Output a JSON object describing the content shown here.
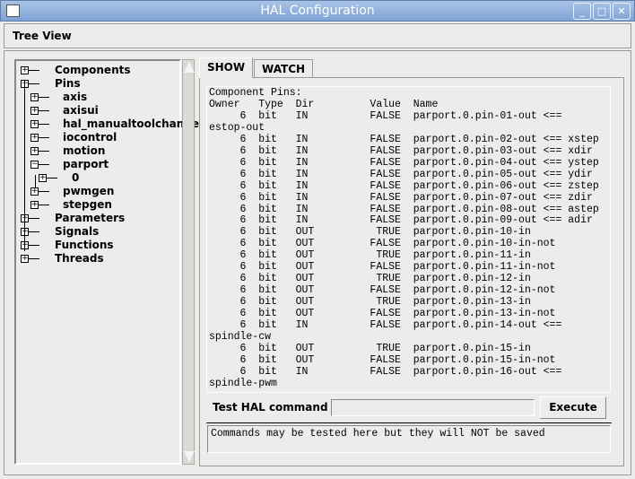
{
  "window": {
    "title": "HAL Configuration",
    "buttons": [
      "minimize",
      "maximize",
      "close"
    ]
  },
  "tree_view_label": "Tree View",
  "tree": [
    {
      "label": "Components",
      "level": 0,
      "expanded": false
    },
    {
      "label": "Pins",
      "level": 0,
      "expanded": true
    },
    {
      "label": "axis",
      "level": 1,
      "expanded": false
    },
    {
      "label": "axisui",
      "level": 1,
      "expanded": false
    },
    {
      "label": "hal_manualtoolchange",
      "level": 1,
      "expanded": false
    },
    {
      "label": "iocontrol",
      "level": 1,
      "expanded": false
    },
    {
      "label": "motion",
      "level": 1,
      "expanded": false
    },
    {
      "label": "parport",
      "level": 1,
      "expanded": true
    },
    {
      "label": "0",
      "level": 2,
      "expanded": false
    },
    {
      "label": "pwmgen",
      "level": 1,
      "expanded": false
    },
    {
      "label": "stepgen",
      "level": 1,
      "expanded": false
    },
    {
      "label": "Parameters",
      "level": 0,
      "expanded": false
    },
    {
      "label": "Signals",
      "level": 0,
      "expanded": false
    },
    {
      "label": "Functions",
      "level": 0,
      "expanded": false
    },
    {
      "label": "Threads",
      "level": 0,
      "expanded": false
    }
  ],
  "tabs": [
    {
      "label": "SHOW",
      "active": true
    },
    {
      "label": "WATCH",
      "active": false
    }
  ],
  "show_text": [
    "Component Pins:",
    "Owner   Type  Dir         Value  Name",
    "     6  bit   IN          FALSE  parport.0.pin-01-out <==",
    "estop-out",
    "     6  bit   IN          FALSE  parport.0.pin-02-out <== xstep",
    "     6  bit   IN          FALSE  parport.0.pin-03-out <== xdir",
    "     6  bit   IN          FALSE  parport.0.pin-04-out <== ystep",
    "     6  bit   IN          FALSE  parport.0.pin-05-out <== ydir",
    "     6  bit   IN          FALSE  parport.0.pin-06-out <== zstep",
    "     6  bit   IN          FALSE  parport.0.pin-07-out <== zdir",
    "     6  bit   IN          FALSE  parport.0.pin-08-out <== astep",
    "     6  bit   IN          FALSE  parport.0.pin-09-out <== adir",
    "     6  bit   OUT          TRUE  parport.0.pin-10-in",
    "     6  bit   OUT         FALSE  parport.0.pin-10-in-not",
    "     6  bit   OUT          TRUE  parport.0.pin-11-in",
    "     6  bit   OUT         FALSE  parport.0.pin-11-in-not",
    "     6  bit   OUT          TRUE  parport.0.pin-12-in",
    "     6  bit   OUT         FALSE  parport.0.pin-12-in-not",
    "     6  bit   OUT          TRUE  parport.0.pin-13-in",
    "     6  bit   OUT         FALSE  parport.0.pin-13-in-not",
    "     6  bit   IN          FALSE  parport.0.pin-14-out <==",
    "spindle-cw",
    "     6  bit   OUT          TRUE  parport.0.pin-15-in",
    "     6  bit   OUT         FALSE  parport.0.pin-15-in-not",
    "     6  bit   IN          FALSE  parport.0.pin-16-out <==",
    "spindle-pwm"
  ],
  "command": {
    "label": "Test HAL command :",
    "value": "",
    "execute_label": "Execute",
    "message": "Commands may be tested here but they will NOT be saved"
  }
}
